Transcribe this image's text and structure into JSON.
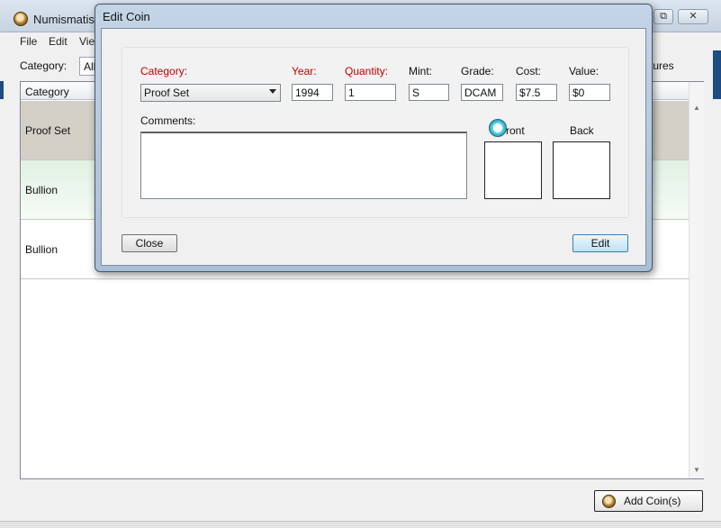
{
  "main_window": {
    "title": "Numismatist",
    "title_buttons": {
      "maximize": "⧉",
      "close": "✕"
    },
    "menu": [
      "File",
      "Edit",
      "Vie"
    ],
    "toolbar": {
      "category_label": "Category:",
      "category_value": "All",
      "pictures_label": "ctures"
    },
    "grid": {
      "header": "Category",
      "rows": [
        "Proof Set",
        "Bullion",
        "Bullion"
      ]
    },
    "add_coin_label": "Add Coin(s)"
  },
  "dialog": {
    "title": "Edit Coin",
    "labels": {
      "category": "Category:",
      "year": "Year:",
      "quantity": "Quantity:",
      "mint": "Mint:",
      "grade": "Grade:",
      "cost": "Cost:",
      "value": "Value:",
      "comments": "Comments:",
      "front": "ront",
      "back": "Back"
    },
    "values": {
      "category": "Proof Set",
      "year": "1994",
      "quantity": "1",
      "mint": "S",
      "grade": "DCAM",
      "cost": "$7.5",
      "value": "$0",
      "comments": ""
    },
    "buttons": {
      "close": "Close",
      "edit": "Edit"
    }
  },
  "colors": {
    "required_label": "#c00000",
    "selected_row": "#d4d0c8",
    "bullion_row": "#e2f1e4"
  }
}
